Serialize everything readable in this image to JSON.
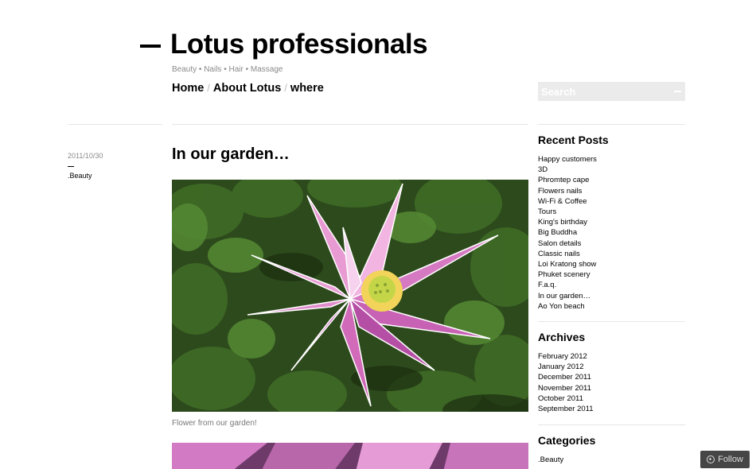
{
  "header": {
    "site_title": "Lotus professionals",
    "tagline": "Beauty • Nails • Hair • Massage"
  },
  "nav": {
    "items": [
      "Home",
      "About Lotus",
      "where"
    ],
    "separator": "/"
  },
  "search": {
    "placeholder": "Search"
  },
  "post": {
    "date": "2011/10/30",
    "category": ".Beauty",
    "title": "In our garden…",
    "caption": "Flower from our garden!"
  },
  "sidebar": {
    "recent_posts": {
      "title": "Recent Posts",
      "items": [
        "Happy customers",
        "3D",
        "Phromtep cape",
        "Flowers nails",
        "Wi-Fi & Coffee",
        "Tours",
        "King's birthday",
        "Big Buddha",
        "Salon details",
        "Classic nails",
        "Loi Kratong show",
        "Phuket scenery",
        "F.a.q.",
        "In our garden…",
        "Ao Yon beach"
      ]
    },
    "archives": {
      "title": "Archives",
      "items": [
        "February 2012",
        "January 2012",
        "December 2011",
        "November 2011",
        "October 2011",
        "September 2011"
      ]
    },
    "categories": {
      "title": "Categories",
      "items": [
        ".Beauty"
      ]
    }
  },
  "follow": {
    "label": "Follow"
  }
}
